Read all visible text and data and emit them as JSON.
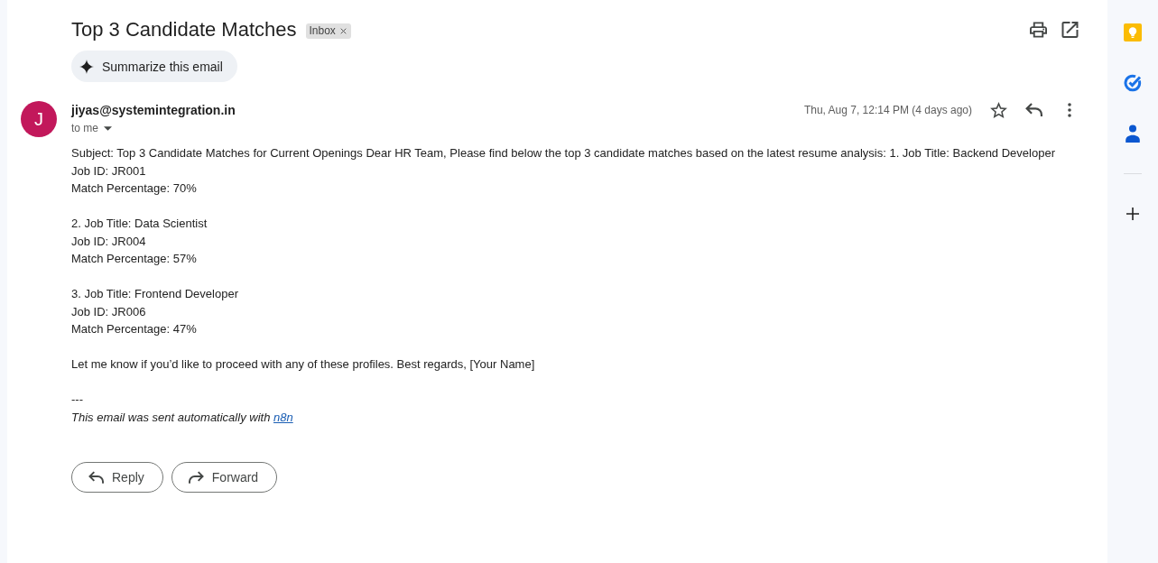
{
  "subject": {
    "title": "Top 3 Candidate Matches",
    "labels": [
      {
        "text": "Inbox"
      }
    ]
  },
  "summarize_button": {
    "label": "Summarize this email"
  },
  "message": {
    "avatar_letter": "J",
    "sender": "jiyas@systemintegration.in",
    "recipients": "to me",
    "date": "Thu, Aug 7, 12:14 PM (4 days ago)",
    "starred": false,
    "body": {
      "paragraphs": [
        {
          "lines": [
            "Subject: Top 3 Candidate Matches for Current Openings Dear HR Team, Please find below the top 3 candidate matches based on the latest resume analysis: 1. Job Title: Backend Developer",
            "Job ID: JR001",
            "Match Percentage: 70%"
          ]
        },
        {
          "lines": [
            "2. Job Title: Data Scientist",
            "Job ID: JR004",
            "Match Percentage: 57%"
          ]
        },
        {
          "lines": [
            "3. Job Title: Frontend Developer",
            "Job ID: JR006",
            "Match Percentage: 47%"
          ]
        },
        {
          "lines": [
            "Let me know if you’d like to proceed with any of these profiles. Best regards, [Your Name]"
          ]
        }
      ],
      "separator": "---",
      "footer": {
        "text": "This email was sent automatically with",
        "link": "n8n"
      }
    }
  },
  "actions": [
    {
      "kind": "reply",
      "label": "Reply"
    },
    {
      "kind": "forward",
      "label": "Forward"
    }
  ]
}
